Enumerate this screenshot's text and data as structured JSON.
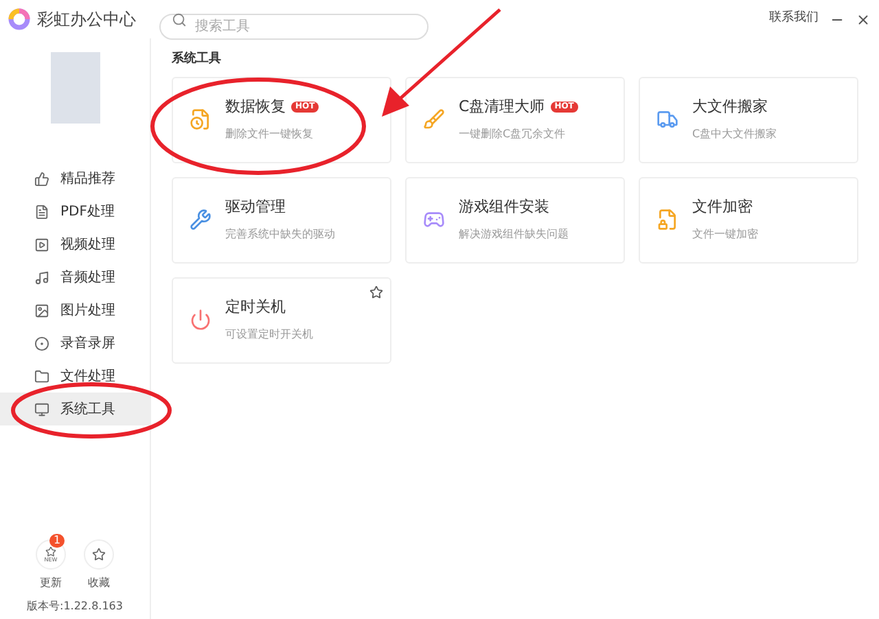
{
  "app": {
    "title": "彩虹办公中心"
  },
  "search": {
    "placeholder": "搜索工具"
  },
  "header": {
    "contact": "联系我们"
  },
  "sidebar": {
    "items": [
      {
        "label": "精品推荐",
        "kind": "thumb",
        "selected": false
      },
      {
        "label": "PDF处理",
        "kind": "pdf",
        "selected": false
      },
      {
        "label": "视频处理",
        "kind": "video",
        "selected": false
      },
      {
        "label": "音频处理",
        "kind": "music",
        "selected": false
      },
      {
        "label": "图片处理",
        "kind": "image",
        "selected": false
      },
      {
        "label": "录音录屏",
        "kind": "record",
        "selected": false
      },
      {
        "label": "文件处理",
        "kind": "folder",
        "selected": false
      },
      {
        "label": "系统工具",
        "kind": "monitor",
        "selected": true
      }
    ],
    "footer": {
      "update": {
        "label": "更新",
        "icon_text": "NEW",
        "badge": "1"
      },
      "favorites": {
        "label": "收藏"
      },
      "version": "版本号:1.22.8.163"
    }
  },
  "section": {
    "title": "系统工具",
    "tools": [
      {
        "title": "数据恢复",
        "desc": "删除文件一键恢复",
        "kind": "restore",
        "hot": "HOT",
        "starred": false
      },
      {
        "title": "C盘清理大师",
        "desc": "一键删除C盘冗余文件",
        "kind": "clean",
        "hot": "HOT",
        "starred": false
      },
      {
        "title": "大文件搬家",
        "desc": "C盘中大文件搬家",
        "kind": "truck",
        "starred": false
      },
      {
        "title": "驱动管理",
        "desc": "完善系统中缺失的驱动",
        "kind": "driver",
        "starred": false
      },
      {
        "title": "游戏组件安装",
        "desc": "解决游戏组件缺失问题",
        "kind": "game",
        "starred": false
      },
      {
        "title": "文件加密",
        "desc": "文件一键加密",
        "kind": "lock",
        "starred": false
      },
      {
        "title": "定时关机",
        "desc": "可设置定时开关机",
        "kind": "power",
        "starred": true
      }
    ]
  }
}
